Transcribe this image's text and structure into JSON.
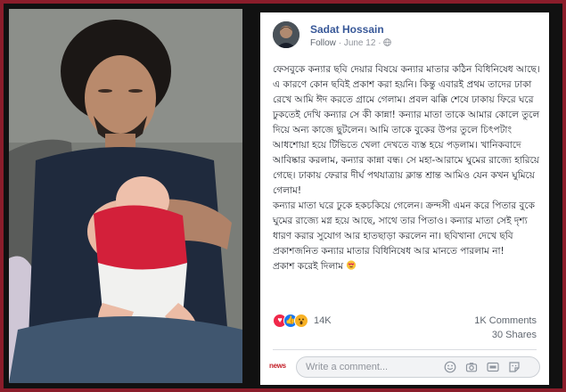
{
  "post": {
    "author": "Sadat Hossain",
    "follow_label": "Follow",
    "date": "June 12",
    "separator": "·",
    "paragraphs": [
      "ফেসবুকে কন্যার ছবি দেয়ার বিষয়ে কন্যার মাতার কঠিন বিধিনিষেধ আছে। এ কারণে কোন ছবিই প্রকাশ করা হয়নি। কিন্তু এবারই প্রথম তাদের ঢাকা রেখে আমি ঈদ করতে গ্রামে গেলাম। প্রবল ঝক্কি শেষে ঢাকায় ফিরে ঘরে ঢুকতেই দেখি কন্যার সে কী কান্না! কন্যার মাতা তাকে আমার কোলে তুলে দিয়ে অন্য কাজে ছুটলেন। আমি তাকে বুকের উপর তুলে চিৎপটাং আধশোয়া হয়ে টিভিতে খেলা দেখতে ব্যস্ত হয়ে পড়লাম। খানিকবাদে আবিষ্কার করলাম, কন্যার কান্না বন্ধ। সে মহা-আরামে ঘুমের রাজ্যে হারিয়ে গেছে। ঢাকায় ফেরার দীর্ঘ পথযাত্রায় ক্লান্ত শ্রান্ত আমিও যেন কখন ঘুমিয়ে গেলাম!",
      "কন্যার মাতা ঘরে ঢুকে হকচকিয়ে গেলেন। ক্রন্দসী এমন করে পিতার বুকে ঘুমের রাজ্যে মগ্ন হয়ে আছে, সাথে তার পিতাও। কন্যার মাতা সেই দৃশ্য ধারণ করার সুযোগ আর হাতছাড়া করলেন না। ছবিখানা দেখে ছবি প্রকাশজনিত কন্যার মাতার বিধিনিষেধ আর মানতে পারলাম না!",
      "প্রকাশ করেই দিলাম"
    ],
    "reaction_count": "14K",
    "comments_count": "1K Comments",
    "shares_count": "30 Shares",
    "comment_placeholder": "Write a comment...",
    "news_logo": "news"
  },
  "icons": {
    "reactions": [
      "love-reaction-icon",
      "like-reaction-icon",
      "wow-reaction-icon"
    ],
    "comment_tools": [
      "smiley-icon",
      "camera-icon",
      "gif-icon",
      "sticker-icon"
    ],
    "globe": "globe-icon",
    "heart_eyes": "heart-eyes-emoji-icon"
  },
  "colors": {
    "border": "#8b1d2b",
    "author": "#385898",
    "like": "#1877f2",
    "love": "#f0284a",
    "wow": "#f7b125"
  }
}
